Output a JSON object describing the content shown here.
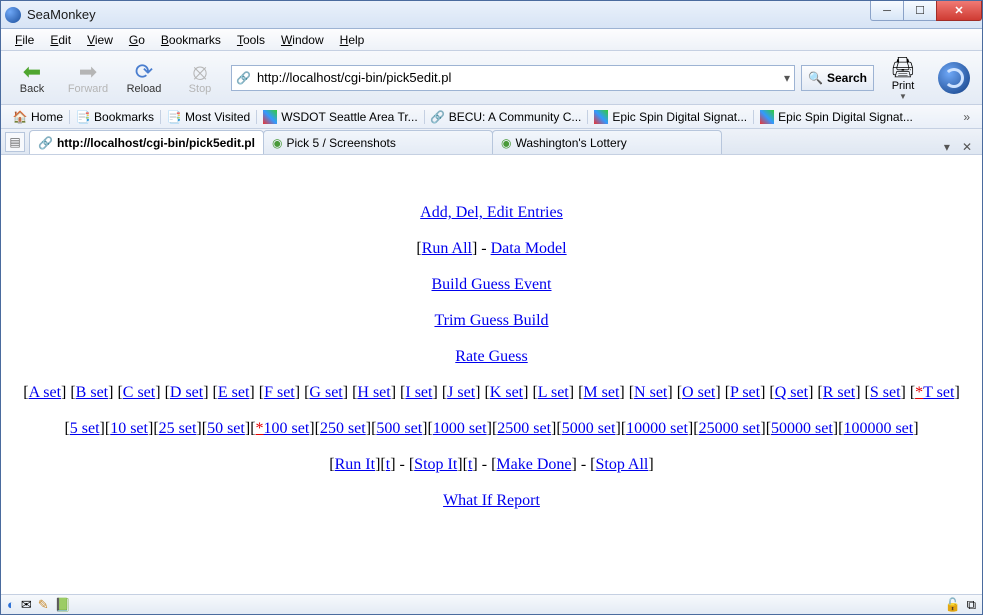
{
  "window": {
    "title": "SeaMonkey"
  },
  "menubar": [
    "File",
    "Edit",
    "View",
    "Go",
    "Bookmarks",
    "Tools",
    "Window",
    "Help"
  ],
  "nav": {
    "back": "Back",
    "forward": "Forward",
    "reload": "Reload",
    "stop": "Stop",
    "print": "Print",
    "search": "Search"
  },
  "url": "http://localhost/cgi-bin/pick5edit.pl",
  "bookmarks_bar": [
    {
      "icon": "home",
      "label": "Home"
    },
    {
      "icon": "book",
      "label": "Bookmarks"
    },
    {
      "icon": "book",
      "label": "Most Visited"
    },
    {
      "icon": "fav",
      "label": "WSDOT Seattle Area Tr..."
    },
    {
      "icon": "link",
      "label": "BECU: A Community C..."
    },
    {
      "icon": "fav",
      "label": "Epic Spin Digital Signat..."
    },
    {
      "icon": "fav",
      "label": "Epic Spin Digital Signat..."
    }
  ],
  "tabs": [
    {
      "icon": "page",
      "label": "http://localhost/cgi-bin/pick5edit.pl",
      "active": true
    },
    {
      "icon": "green",
      "label": "Pick 5 / Screenshots",
      "active": false
    },
    {
      "icon": "green",
      "label": "Washington's Lottery",
      "active": false
    }
  ],
  "page": {
    "links_top": "Add, Del, Edit Entries",
    "run_all": "Run All",
    "data_model": "Data Model",
    "build_guess": "Build Guess Event",
    "trim_guess": "Trim Guess Build",
    "rate_guess": "Rate Guess",
    "letter_sets": [
      "A set",
      "B set",
      "C set",
      "D set",
      "E set",
      "F set",
      "G set",
      "H set",
      "I set",
      "J set",
      "K set",
      "L set",
      "M set",
      "N set",
      "O set",
      "P set",
      "Q set",
      "R set",
      "S set"
    ],
    "letter_set_marked": "T set",
    "num_sets_pre": [
      "5 set",
      "10 set",
      "25 set",
      "50 set"
    ],
    "num_set_marked": "100 set",
    "num_sets_post": [
      "250 set",
      "500 set",
      "1000 set",
      "2500 set",
      "5000 set",
      "10000 set",
      "25000 set",
      "50000 set",
      "100000 set"
    ],
    "run_it": "Run It",
    "t1": "t",
    "stop_it": "Stop It",
    "t2": "t",
    "make_done": "Make Done",
    "stop_all": "Stop All",
    "what_if": "What If Report"
  }
}
